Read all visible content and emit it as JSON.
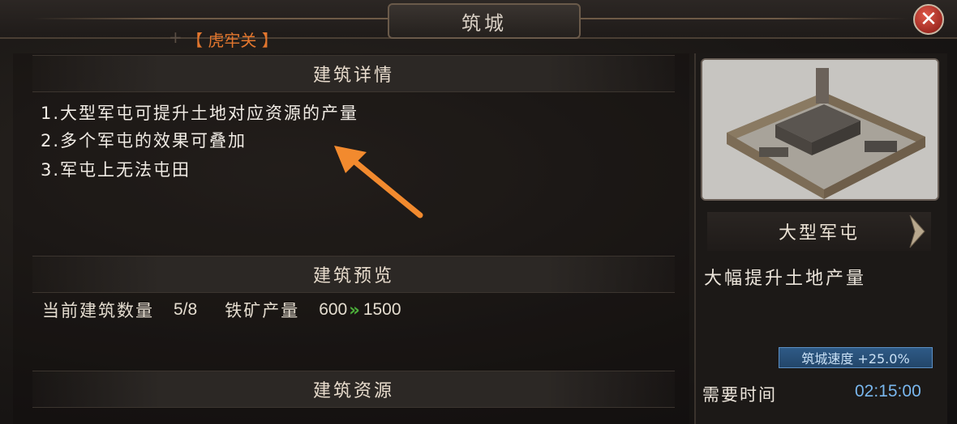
{
  "window": {
    "title": "筑城",
    "location": "【 虎牢关 】"
  },
  "details": {
    "header": "建筑详情",
    "lines": [
      "1.大型军屯可提升土地对应资源的产量",
      "2.多个军屯的效果可叠加",
      "3.军屯上无法屯田"
    ]
  },
  "preview": {
    "header": "建筑预览",
    "count_label": "当前建筑数量",
    "count_value": "5/8",
    "output_label": "铁矿产量",
    "output_from": "600",
    "output_arrow": "»",
    "output_to": "1500"
  },
  "resources": {
    "header": "建筑资源"
  },
  "building": {
    "name": "大型军屯",
    "description": "大幅提升土地产量",
    "speed_bonus": "筑城速度 +25.0%",
    "time_label": "需要时间",
    "time_value": "02:15:00"
  },
  "colors": {
    "accent_orange": "#e2762e",
    "annotation_arrow": "#f28a2e",
    "speed_blue": "#79b7ee",
    "upgrade_green": "#4caf3a"
  },
  "icons": {
    "close": "close-icon",
    "prev": "chevron-left-icon",
    "next": "chevron-right-icon"
  }
}
